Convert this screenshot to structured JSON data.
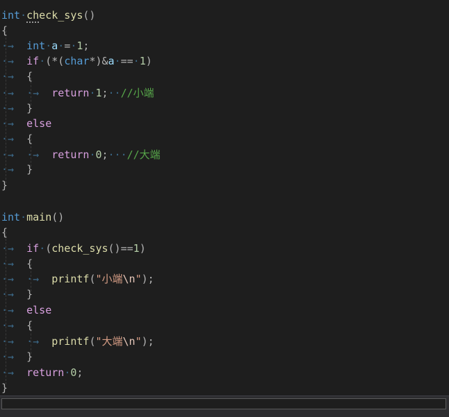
{
  "editor": {
    "language": "C",
    "lines": [
      "int check_sys()",
      "{",
      "    int a = 1;",
      "    if (*(char*)&a == 1)",
      "    {",
      "        return 1;  //小端",
      "    }",
      "    else",
      "    {",
      "        return 0;   //大端",
      "    }",
      "}",
      "",
      "int main()",
      "{",
      "    if (check_sys()==1)",
      "    {",
      "        printf(\"小端\\n\");",
      "    }",
      "    else",
      "    {",
      "        printf(\"大端\\n\");",
      "    }",
      "    return 0;",
      "}"
    ],
    "tokens": {
      "kw_int": "int",
      "fn_check_sys": "check_sys",
      "fn_main": "main",
      "kw_char": "char",
      "kw_if": "if",
      "kw_else": "else",
      "kw_return": "return",
      "var_a": "a",
      "num_1": "1",
      "num_0": "0",
      "comment_little": "//小端",
      "comment_big": "//大端",
      "fn_printf": "printf",
      "str_little": "小端",
      "str_big": "大端",
      "escape_newline": "\\n"
    }
  },
  "colors": {
    "background": "#1e1e1e",
    "keyword": "#569cd6",
    "control": "#d8a0df",
    "function": "#dcdcaa",
    "variable": "#9cdcfe",
    "number": "#b5cea8",
    "string": "#d69d85",
    "comment": "#57a64a"
  }
}
